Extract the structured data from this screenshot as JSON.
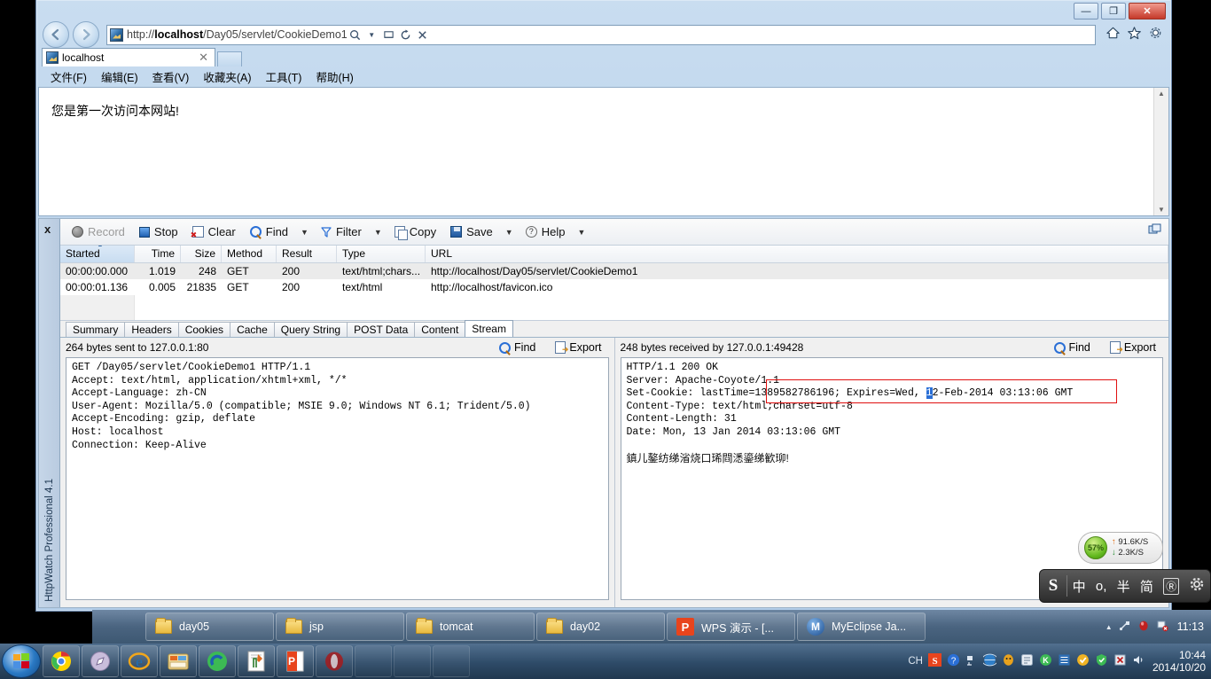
{
  "window": {
    "minimize": "—",
    "maximize": "❐",
    "close": "✕"
  },
  "browser": {
    "back_icon": "◀",
    "forward_icon": "▶",
    "address_value": "http://localhost/Day05/servlet/CookieDemo1",
    "address_host": "localhost",
    "address_prefix": "http://",
    "address_suffix": "/Day05/servlet/CookieDemo1",
    "addr_icons": [
      "search-icon",
      "caret-down-icon",
      "compat-view-icon",
      "refresh-icon",
      "stop-icon"
    ],
    "tool_icons": [
      "home-icon",
      "favorites-icon",
      "tools-icon"
    ],
    "tab_title": "localhost",
    "tab_close": "✕",
    "menu": [
      "文件(F)",
      "编辑(E)",
      "查看(V)",
      "收藏夹(A)",
      "工具(T)",
      "帮助(H)"
    ],
    "page_text": "您是第一次访问本网站!"
  },
  "httpwatch": {
    "close_label": "x",
    "product_label": "HttpWatch Professional 4.1",
    "toolbar": [
      {
        "label": "Record",
        "icon": "record-icon",
        "disabled": true,
        "caret": false
      },
      {
        "label": "Stop",
        "icon": "stop-icon",
        "disabled": false,
        "caret": false
      },
      {
        "label": "Clear",
        "icon": "clear-icon",
        "disabled": false,
        "caret": false
      },
      {
        "label": "Find",
        "icon": "find-icon",
        "disabled": false,
        "caret": true
      },
      {
        "label": "Filter",
        "icon": "filter-icon",
        "disabled": false,
        "caret": true
      },
      {
        "label": "Copy",
        "icon": "copy-icon",
        "disabled": false,
        "caret": false
      },
      {
        "label": "Save",
        "icon": "save-icon",
        "disabled": false,
        "caret": true
      },
      {
        "label": "Help",
        "icon": "help-icon",
        "disabled": false,
        "caret": true
      }
    ],
    "grid": {
      "headers": [
        "Started",
        "Time",
        "Size",
        "Method",
        "Result",
        "Type",
        "URL"
      ],
      "sorted_column": "Started",
      "rows": [
        {
          "started": "00:00:00.000",
          "time": "1.019",
          "size": "248",
          "method": "GET",
          "result": "200",
          "type": "text/html;chars...",
          "url": "http://localhost/Day05/servlet/CookieDemo1",
          "selected": true
        },
        {
          "started": "00:00:01.136",
          "time": "0.005",
          "size": "21835",
          "method": "GET",
          "result": "200",
          "type": "text/html",
          "url": "http://localhost/favicon.ico",
          "selected": false
        }
      ]
    },
    "tabs": [
      {
        "label": "Summary",
        "active": false
      },
      {
        "label": "Headers",
        "active": false
      },
      {
        "label": "Cookies",
        "active": false
      },
      {
        "label": "Cache",
        "active": false
      },
      {
        "label": "Query String",
        "active": false
      },
      {
        "label": "POST Data",
        "active": false
      },
      {
        "label": "Content",
        "active": false
      },
      {
        "label": "Stream",
        "active": true
      }
    ],
    "request_pane": {
      "title": "264 bytes sent to 127.0.0.1:80",
      "find_label": "Find",
      "export_label": "Export",
      "text": "GET /Day05/servlet/CookieDemo1 HTTP/1.1\nAccept: text/html, application/xhtml+xml, */*\nAccept-Language: zh-CN\nUser-Agent: Mozilla/5.0 (compatible; MSIE 9.0; Windows NT 6.1; Trident/5.0)\nAccept-Encoding: gzip, deflate\nHost: localhost\nConnection: Keep-Alive"
    },
    "response_pane": {
      "title": "248 bytes received by 127.0.0.1:49428",
      "find_label": "Find",
      "export_label": "Export",
      "line1": "HTTP/1.1 200 OK",
      "line2": "Server: Apache-Coyote/1.1",
      "line3_pre": "Set-Cookie: lastTime=1389582786196; Expires=Wed, ",
      "line3_hl": "1",
      "line3_post": "2-Feb-2014 03:13:06 GMT",
      "line4": "Content-Type: text/html;charset=utf-8",
      "line5": "Content-Length: 31",
      "line6": "Date: Mon, 13 Jan 2014 03:13:06 GMT",
      "body_text": "鎮儿鏊纺绨渻烧口琋閰㴽鎏绨歓珋!",
      "highlight_color": "#e01010",
      "selection_color": "#2a6fd6"
    }
  },
  "taskbar_upper": {
    "items": [
      {
        "label": "day05",
        "icon": "folder-icon"
      },
      {
        "label": "jsp",
        "icon": "folder-icon"
      },
      {
        "label": "tomcat",
        "icon": "folder-icon"
      },
      {
        "label": "day02",
        "icon": "folder-icon"
      },
      {
        "label": "WPS 演示 - [...",
        "icon": "wps-icon"
      },
      {
        "label": "MyEclipse Ja...",
        "icon": "myeclipse-icon"
      }
    ],
    "tray_icons": [
      "show-hidden-icon",
      "usb-icon",
      "shield-red-icon",
      "flag-error-icon"
    ],
    "clock": "11:13"
  },
  "taskbar_lower": {
    "start_icon": "windows-start-icon",
    "quick_icons": [
      "chrome-icon",
      "safari-icon",
      "ie-icon",
      "explorer-icon",
      "maxthon-icon",
      "notepad-icon",
      "powerpoint-icon",
      "opera-icon",
      "app-icon",
      "browser-icon"
    ],
    "tray_text": "CH",
    "tray_icons": [
      "sogou-icon",
      "help-icon",
      "network-icon",
      "globe-icon",
      "qq-icon",
      "app1-icon",
      "kingsoft-icon",
      "list-icon",
      "shield-green-icon",
      "guard-icon",
      "close-red-icon",
      "volume-icon"
    ],
    "clock_time": "10:44",
    "clock_date": "2014/10/20"
  },
  "netspeed": {
    "percent": "57%",
    "up": "91.6K/S",
    "down": "2.3K/S",
    "up_arrow": "↑",
    "down_arrow": "↓"
  },
  "ime": {
    "logo": "S",
    "items": [
      "中",
      "ο,",
      "半",
      "简",
      "Ⓡ"
    ],
    "settings_icon": "gear-icon"
  }
}
